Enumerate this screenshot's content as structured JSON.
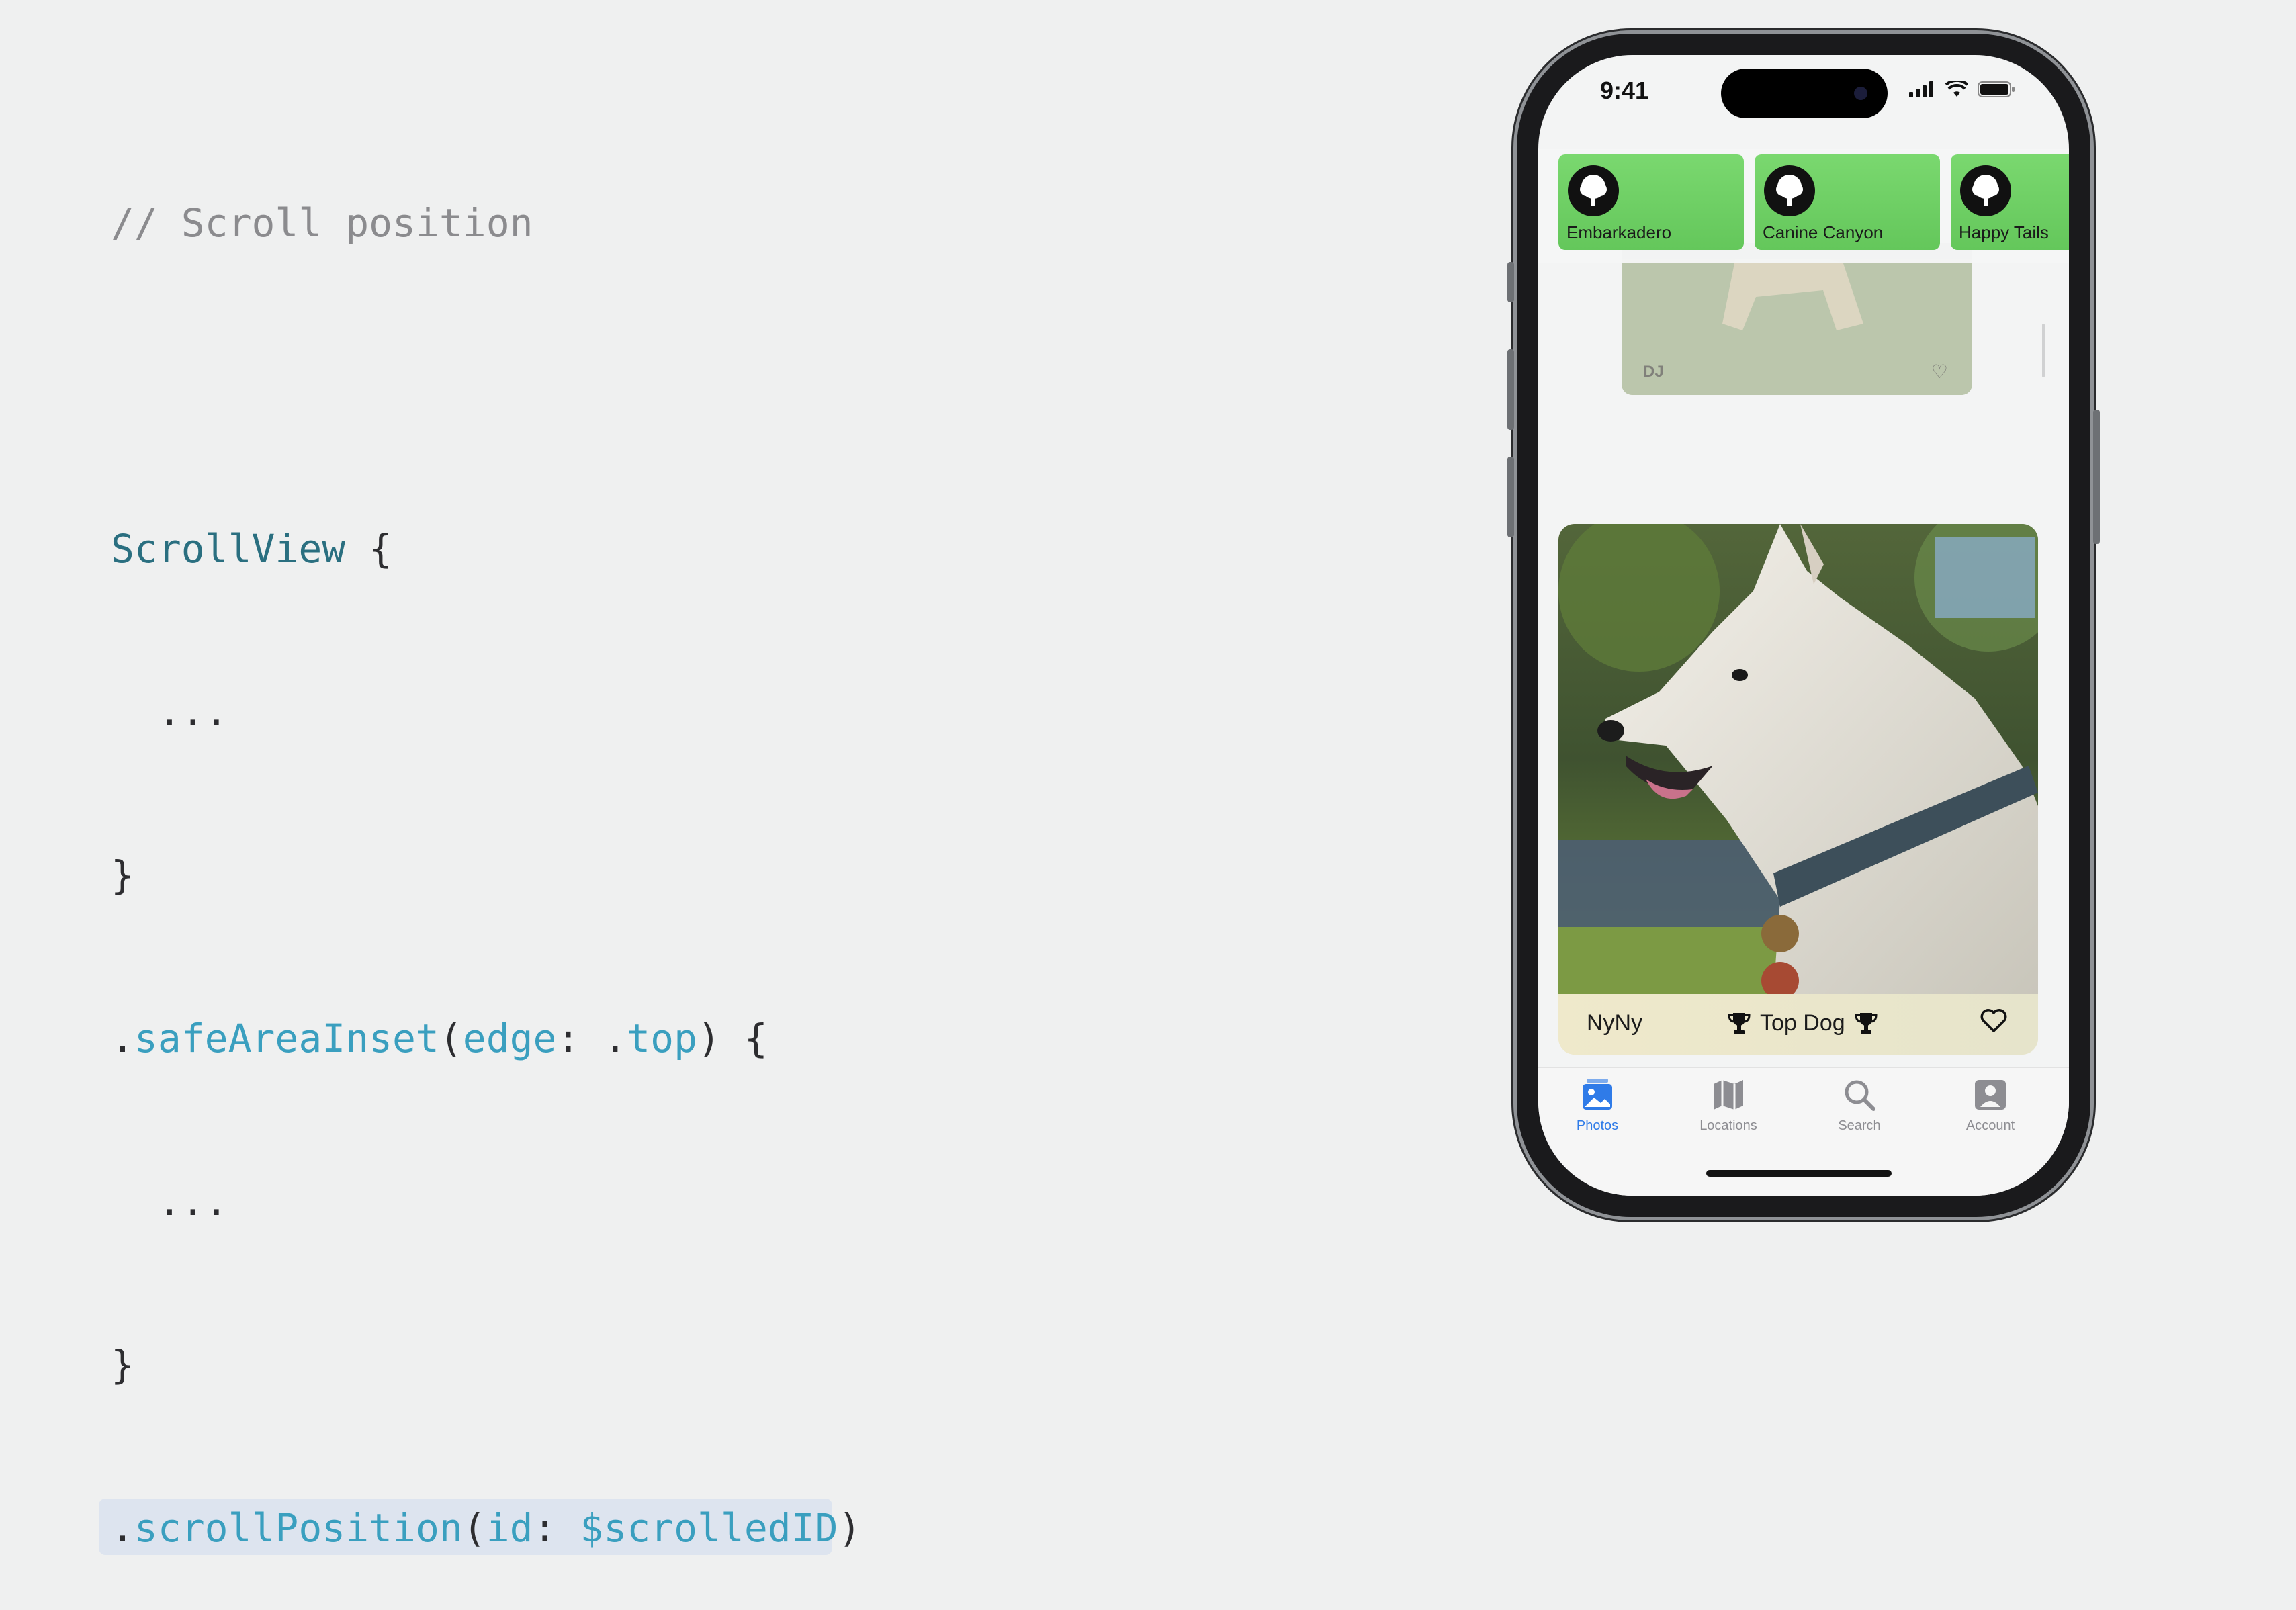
{
  "code": {
    "comment": "// Scroll position",
    "lines": {
      "l1_type": "ScrollView",
      "l1_rest": " {",
      "l2": "  ...",
      "l3": "}",
      "l4_dot": ".",
      "l4_fn": "safeAreaInset",
      "l4_p1": "(",
      "l4_arg": "edge",
      "l4_p2": ": .",
      "l4_val": "top",
      "l4_p3": ") {",
      "l5": "  ...",
      "l6": "}",
      "l7_dot": ".",
      "l7_fn": "scrollPosition",
      "l7_p1": "(",
      "l7_arg": "id",
      "l7_p2": ": ",
      "l7_val": "$scrolledID",
      "l7_p3": ")"
    }
  },
  "phone": {
    "time": "9:41",
    "chips": [
      {
        "label": "Embarkadero"
      },
      {
        "label": "Canine Canyon"
      },
      {
        "label": "Happy Tails"
      }
    ],
    "prev_card": {
      "name": "DJ"
    },
    "card": {
      "name": "NyNy",
      "badge": "Top Dog"
    },
    "tabs": [
      {
        "label": "Photos",
        "icon": "photos-icon",
        "active": true
      },
      {
        "label": "Locations",
        "icon": "map-icon",
        "active": false
      },
      {
        "label": "Search",
        "icon": "search-icon",
        "active": false
      },
      {
        "label": "Account",
        "icon": "person-icon",
        "active": false
      }
    ],
    "colors": {
      "accent": "#2f7be8",
      "chip": "#6fd265"
    }
  }
}
